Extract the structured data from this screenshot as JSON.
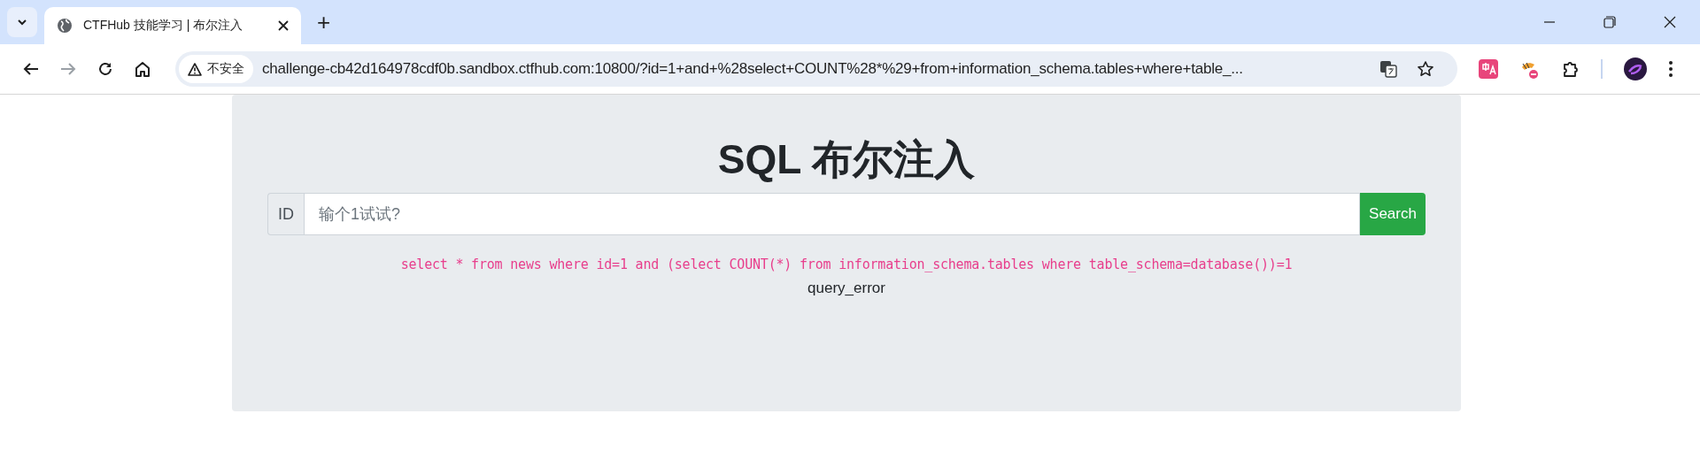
{
  "browser": {
    "tab": {
      "title": "CTFHub 技能学习 | 布尔注入",
      "selected": true
    },
    "new_tab": "+",
    "security_label": "不安全",
    "url": "challenge-cb42d164978cdf0b.sandbox.ctfhub.com:10800/?id=1+and+%28select+COUNT%28*%29+from+information_schema.tables+where+table_..."
  },
  "page": {
    "title": "SQL 布尔注入",
    "input_prefix": "ID",
    "input": {
      "placeholder": "输个1试试?"
    },
    "button": "Search",
    "query": "select * from news where id=1 and (select COUNT(*) from information_schema.tables where table_schema=database())=1",
    "result": "query_error"
  }
}
